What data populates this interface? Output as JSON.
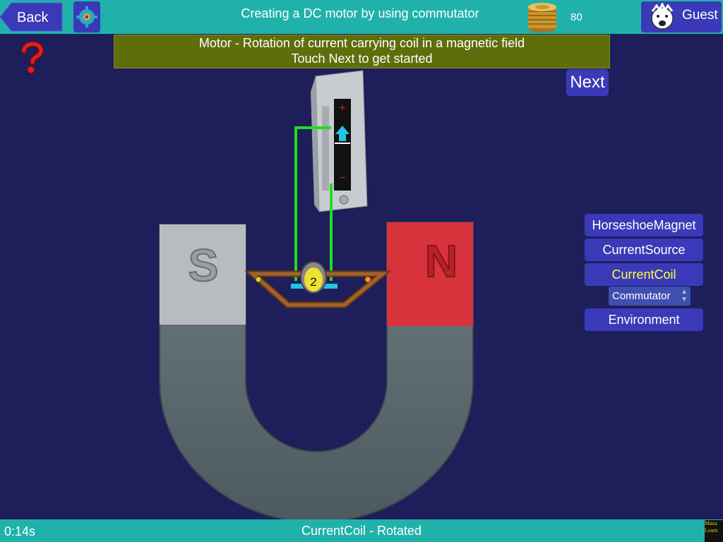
{
  "header": {
    "back_label": "Back",
    "title": "Creating a DC  motor by using commutator",
    "score": "80",
    "user_label": "Guest"
  },
  "banner": {
    "line1": "Motor - Rotation of current carrying coil in a magnetic field",
    "line2": "Touch Next to get started"
  },
  "next_label": "Next",
  "scene": {
    "magnet_s_label": "S",
    "magnet_n_label": "N",
    "coil_label": "2",
    "source_plus": "+",
    "source_minus": "−"
  },
  "side_panel": {
    "items": [
      {
        "label": "HorseshoeMagnet"
      },
      {
        "label": "CurrentSource"
      },
      {
        "label": "CurrentCoil"
      },
      {
        "label": "Environment"
      }
    ],
    "dropdown_value": "Commutator"
  },
  "footer": {
    "timer": "0:14s",
    "status": "CurrentCoil - Rotated",
    "logo_line1": "Maza",
    "logo_line2": "Learn"
  },
  "colors": {
    "background": "#1e1e5a",
    "bar": "#20b2aa",
    "button": "#3a3ab8",
    "banner": "#5f6e0b",
    "wire": "#22dd22",
    "magnet_red": "#d8323c",
    "active_text": "#ffff44"
  },
  "icons": [
    "back-arrow-icon",
    "gear-icon",
    "coins-icon",
    "guest-avatar-icon",
    "question-mark-icon"
  ]
}
